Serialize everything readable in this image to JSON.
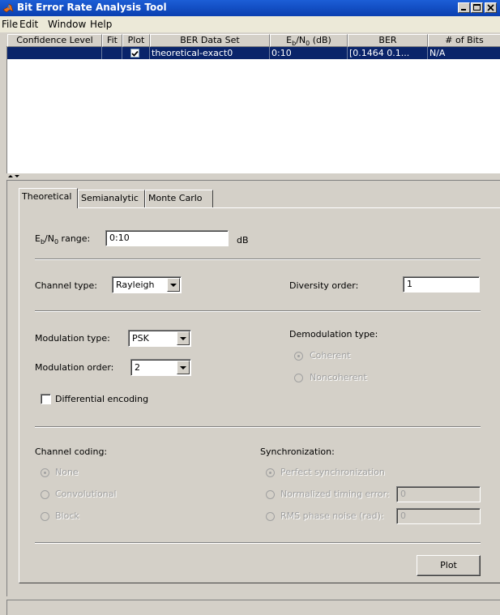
{
  "window": {
    "title": "Bit Error Rate Analysis Tool"
  },
  "menu": [
    "File",
    "Edit",
    "Window",
    "Help"
  ],
  "table": {
    "columns": [
      "Confidence Level",
      "Fit",
      "Plot",
      "BER Data Set",
      "E_b/N_0 (dB)",
      "BER",
      "# of Bits"
    ],
    "rows": [
      {
        "confidence": "",
        "fit": "",
        "plot_checked": true,
        "dataset": "theoretical-exact0",
        "ebno": "0:10",
        "ber": "[0.1464  0.1...",
        "bits": "N/A"
      }
    ]
  },
  "tabs": [
    "Theoretical",
    "Semianalytic",
    "Monte Carlo"
  ],
  "active_tab": "Theoretical",
  "theoretical": {
    "ebno_label_pre": "E",
    "ebno_label_sub1": "b",
    "ebno_label_mid": "/N",
    "ebno_label_sub2": "0",
    "ebno_label_post": " range:",
    "ebno_value": "0:10",
    "ebno_unit": "dB",
    "channel_type_label": "Channel type:",
    "channel_type_value": "Rayleigh",
    "diversity_label": "Diversity order:",
    "diversity_value": "1",
    "modulation_type_label": "Modulation type:",
    "modulation_type_value": "PSK",
    "modulation_order_label": "Modulation order:",
    "modulation_order_value": "2",
    "demod_label": "Demodulation type:",
    "demod_options": [
      "Coherent",
      "Noncoherent"
    ],
    "demod_selected": "Coherent",
    "diff_encoding_label": "Differential encoding",
    "diff_encoding_checked": false,
    "channel_coding_label": "Channel coding:",
    "channel_coding_options": [
      "None",
      "Convolutional",
      "Block"
    ],
    "channel_coding_selected": "None",
    "sync_label": "Synchronization:",
    "sync_options": [
      "Perfect synchronization",
      "Normalized timing error:",
      "RMS phase noise (rad):"
    ],
    "sync_selected": "Perfect synchronization",
    "timing_error_value": "0",
    "phase_noise_value": "0",
    "plot_button": "Plot"
  },
  "colors": {
    "title_bar": "#0a3fb0",
    "selection": "#0a246a",
    "face": "#d4d0c8"
  }
}
